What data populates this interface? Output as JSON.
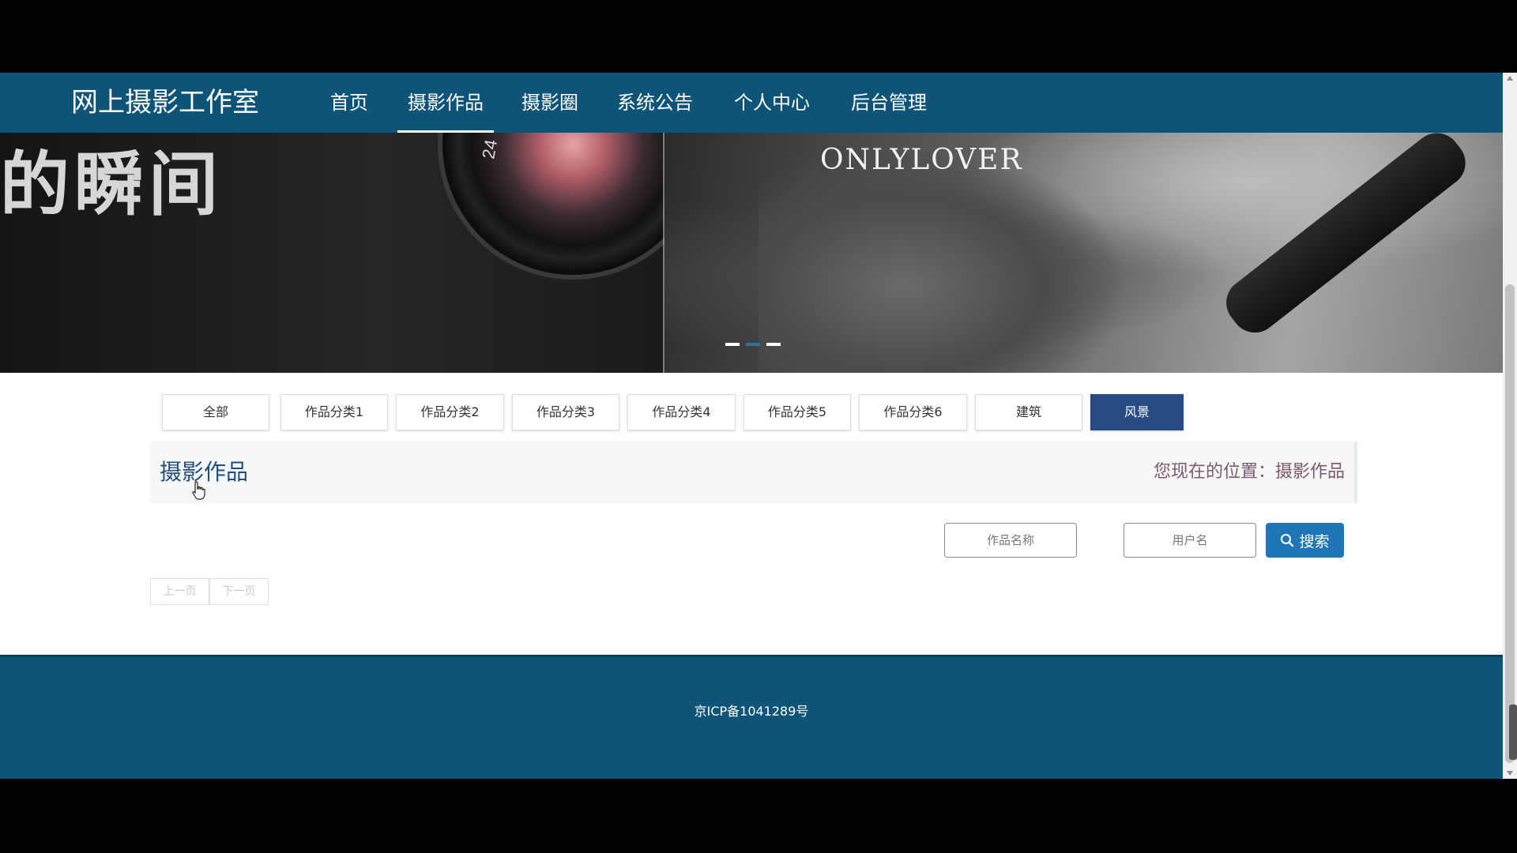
{
  "brand": "网上摄影工作室",
  "nav": [
    {
      "label": "首页",
      "active": false
    },
    {
      "label": "摄影作品",
      "active": true
    },
    {
      "label": "摄影圈",
      "active": false
    },
    {
      "label": "系统公告",
      "active": false
    },
    {
      "label": "个人中心",
      "active": false
    },
    {
      "label": "后台管理",
      "active": false
    }
  ],
  "banner": {
    "headline_cn": "的瞬间",
    "headline_en": "ONLYLOVER",
    "lens_mark": "24",
    "slides_total": 3,
    "active_slide": 2
  },
  "categories": [
    {
      "label": "全部",
      "active": false
    },
    {
      "label": "作品分类1",
      "active": false
    },
    {
      "label": "作品分类2",
      "active": false
    },
    {
      "label": "作品分类3",
      "active": false
    },
    {
      "label": "作品分类4",
      "active": false
    },
    {
      "label": "作品分类5",
      "active": false
    },
    {
      "label": "作品分类6",
      "active": false
    },
    {
      "label": "建筑",
      "active": false
    },
    {
      "label": "风景",
      "active": true
    }
  ],
  "page": {
    "title": "摄影作品",
    "location": "您现在的位置：摄影作品"
  },
  "search": {
    "work_name_placeholder": "作品名称",
    "username_placeholder": "用户名",
    "button_label": "搜索"
  },
  "pager": {
    "prev_label": "上一页",
    "next_label": "下一页"
  },
  "footer": {
    "icp": "京ICP备1041289号"
  },
  "colors": {
    "nav_bg": "#0e5478",
    "active_category": "#264b82",
    "search_button": "#1e76b6"
  }
}
